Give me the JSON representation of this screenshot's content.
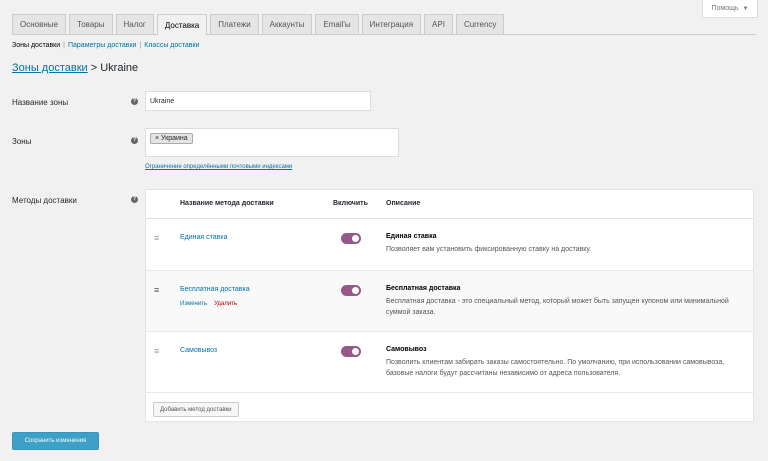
{
  "help": {
    "label": "Помощь"
  },
  "tabs": [
    {
      "label": "Основные",
      "active": false
    },
    {
      "label": "Товары",
      "active": false
    },
    {
      "label": "Налог",
      "active": false
    },
    {
      "label": "Доставка",
      "active": true
    },
    {
      "label": "Платежи",
      "active": false
    },
    {
      "label": "Аккаунты",
      "active": false
    },
    {
      "label": "Email'ы",
      "active": false
    },
    {
      "label": "Интеграция",
      "active": false
    },
    {
      "label": "API",
      "active": false
    },
    {
      "label": "Currency",
      "active": false
    }
  ],
  "subnav": {
    "zones": "Зоны доставки",
    "options": "Параметры доставки",
    "classes": "Классы доставки"
  },
  "breadcrumb": {
    "link": "Зоны доставки",
    "sep": ">",
    "current": "Ukraine"
  },
  "zone_name": {
    "label": "Название зоны",
    "value": "Ukraine"
  },
  "regions": {
    "label": "Зоны",
    "token": "× Украина",
    "postcode_link": "Ограничение определёнными почтовыми индексами"
  },
  "methods": {
    "label": "Методы доставки",
    "headers": {
      "name": "Название метода доставки",
      "enabled": "Включить",
      "description": "Описание"
    },
    "rows": [
      {
        "title": "Единая ставка",
        "enabled": true,
        "desc_title": "Единая ставка",
        "desc_text": "Позволяет вам установить фиксированную ставку на доставку.",
        "actions": null
      },
      {
        "title": "Бесплатная доставка",
        "enabled": true,
        "desc_title": "Бесплатная доставка",
        "desc_text": "Бесплатная доставка - это специальный метод, который может быть запущен купоном или минимальной суммой заказа.",
        "actions": {
          "edit": "Изменить",
          "delete": "Удалить"
        }
      },
      {
        "title": "Самовывоз",
        "enabled": true,
        "desc_title": "Самовывоз",
        "desc_text": "Позволить клиентам забирать заказы самостоятельно. По умолчанию, при использовании самовывоза, базовые налоги будут рассчитаны независимо от адреса пользователя.",
        "actions": null
      }
    ],
    "add_button": "Добавить метод доставки"
  },
  "save_button": "Сохранить изменения",
  "colors": {
    "accent": "#96588a",
    "link": "#0073aa",
    "primary": "#0085ba"
  }
}
